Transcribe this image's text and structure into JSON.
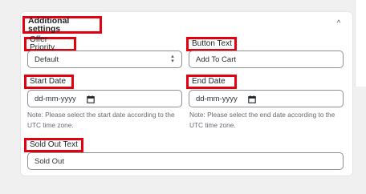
{
  "section": {
    "title": "Additional settings",
    "collapse_glyph": "^"
  },
  "offer_priority": {
    "label": "Offer Priority",
    "value": "Default",
    "icon": "select-arrows-icon"
  },
  "button_text": {
    "label": "Button Text",
    "value": "Add To Cart"
  },
  "start_date": {
    "label": "Start Date",
    "placeholder": "dd-mm-yyyy",
    "note": [
      "Note: Please select the start date according to the",
      "UTC time zone."
    ],
    "icon": "calendar-icon"
  },
  "end_date": {
    "label": "End Date",
    "placeholder": "dd-mm-yyyy",
    "note": [
      "Note: Please select the end date according to the",
      "UTC time zone."
    ],
    "icon": "calendar-icon"
  },
  "sold_out_text": {
    "label": "Sold Out Text",
    "value": "Sold Out"
  },
  "colors": {
    "highlight": "#e3000f",
    "border": "#8c8f94",
    "note_text": "#646970"
  }
}
